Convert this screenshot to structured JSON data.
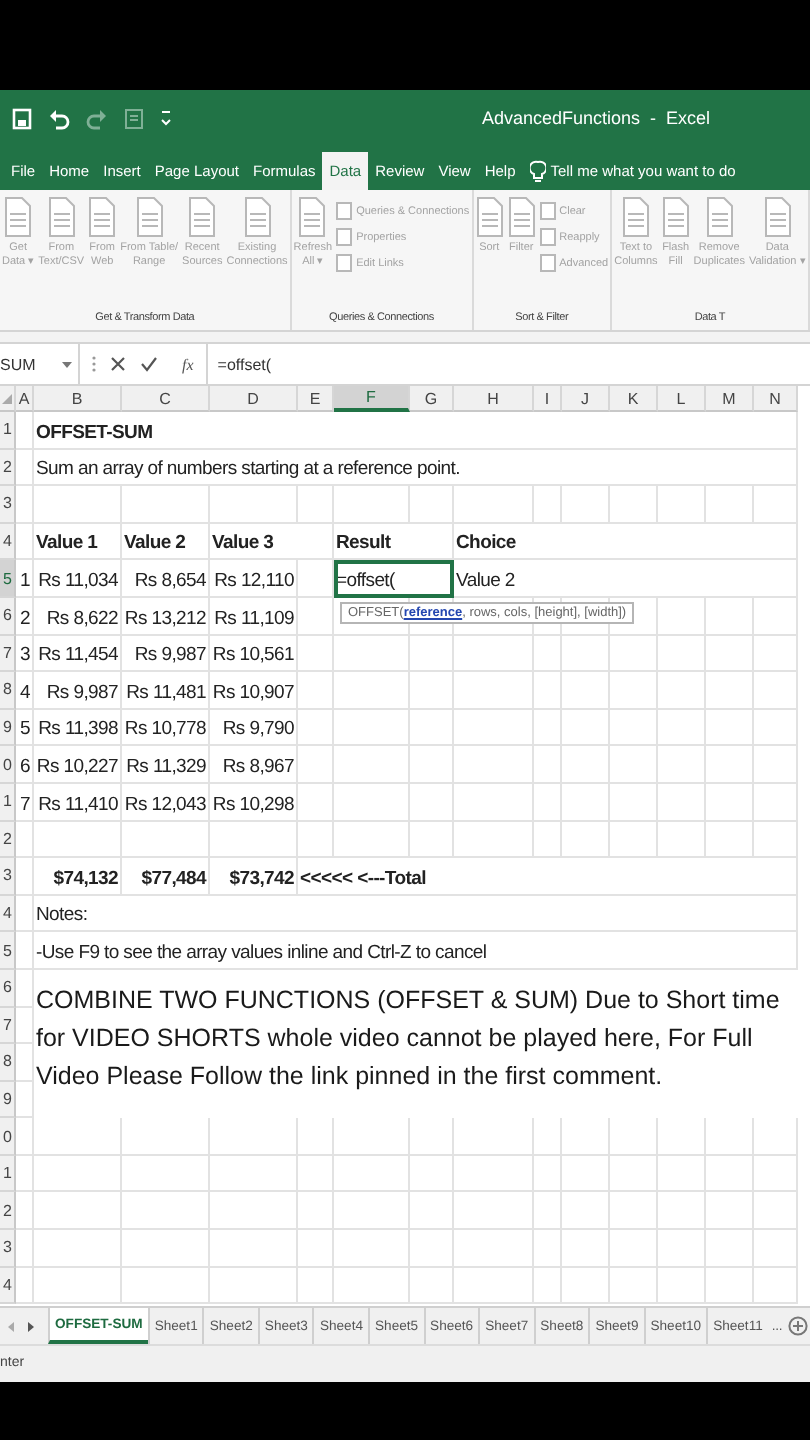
{
  "window": {
    "title": "AdvancedFunctions  -  Excel"
  },
  "ribbon_tabs": [
    {
      "label": "File",
      "selected": false
    },
    {
      "label": "Home",
      "selected": false
    },
    {
      "label": "Insert",
      "selected": false
    },
    {
      "label": "Page Layout",
      "selected": false
    },
    {
      "label": "Formulas",
      "selected": false
    },
    {
      "label": "Data",
      "selected": true
    },
    {
      "label": "Review",
      "selected": false
    },
    {
      "label": "View",
      "selected": false
    },
    {
      "label": "Help",
      "selected": false
    }
  ],
  "tell_me": {
    "label": "Tell me what you want to do"
  },
  "ribbon": {
    "disabled": true,
    "groups": [
      {
        "label": "Get & Transform Data",
        "commands": [
          {
            "kind": "large",
            "label": "Get\nData ▾"
          },
          {
            "kind": "large",
            "label": "From\nText/CSV"
          },
          {
            "kind": "large",
            "label": "From\nWeb"
          },
          {
            "kind": "large",
            "label": "From Table/\nRange"
          },
          {
            "kind": "large",
            "label": "Recent\nSources"
          },
          {
            "kind": "large",
            "label": "Existing\nConnections"
          }
        ]
      },
      {
        "label": "Queries & Connections",
        "commands": [
          {
            "kind": "large",
            "label": "Refresh\nAll ▾"
          },
          {
            "kind": "stack",
            "items": [
              "Queries & Connections",
              "Properties",
              "Edit Links"
            ]
          }
        ]
      },
      {
        "label": "Sort & Filter",
        "commands": [
          {
            "kind": "large",
            "label": "Sort"
          },
          {
            "kind": "large",
            "label": "Filter"
          },
          {
            "kind": "stack",
            "items": [
              "Clear",
              "Reapply",
              "Advanced"
            ]
          }
        ]
      },
      {
        "label": "Data T",
        "commands": [
          {
            "kind": "large",
            "label": "Text to\nColumns"
          },
          {
            "kind": "large",
            "label": "Flash\nFill"
          },
          {
            "kind": "large",
            "label": "Remove\nDuplicates"
          },
          {
            "kind": "large",
            "label": "Data\nValidation ▾"
          }
        ]
      }
    ]
  },
  "formula_bar": {
    "name_box": "SUM",
    "insert_function": "fx",
    "formula": "=offset("
  },
  "columns": [
    {
      "label": "A",
      "selected": false
    },
    {
      "label": "B",
      "selected": false
    },
    {
      "label": "C",
      "selected": false
    },
    {
      "label": "D",
      "selected": false
    },
    {
      "label": "E",
      "selected": false
    },
    {
      "label": "F",
      "selected": true
    },
    {
      "label": "G",
      "selected": false
    },
    {
      "label": "H",
      "selected": false
    },
    {
      "label": "I",
      "selected": false
    },
    {
      "label": "J",
      "selected": false
    },
    {
      "label": "K",
      "selected": false
    },
    {
      "label": "L",
      "selected": false
    },
    {
      "label": "M",
      "selected": false
    },
    {
      "label": "N",
      "selected": false
    }
  ],
  "rows": [
    {
      "number": "1",
      "selected": false,
      "cells": {
        "B": {
          "kind": "text",
          "text": "OFFSET-SUM",
          "bold": true,
          "active": false
        }
      }
    },
    {
      "number": "2",
      "selected": false,
      "cells": {
        "B": {
          "kind": "text",
          "text": "Sum an array of numbers starting at a reference point.",
          "bold": false,
          "active": false
        }
      }
    },
    {
      "number": "3",
      "selected": false
    },
    {
      "number": "4",
      "selected": false,
      "cells": {
        "B": {
          "kind": "text",
          "text": "Value 1",
          "bold": true,
          "active": false
        },
        "C": {
          "kind": "text",
          "text": "Value 2",
          "bold": true,
          "active": false
        },
        "D": {
          "kind": "text",
          "text": "Value 3",
          "bold": true,
          "active": false
        },
        "F": {
          "kind": "text",
          "text": "Result",
          "bold": true,
          "active": false
        },
        "H": {
          "kind": "text",
          "text": "Choice",
          "bold": true,
          "active": false
        }
      }
    },
    {
      "number": "5",
      "selected": true,
      "cells": {
        "A": {
          "kind": "number",
          "text": "1",
          "bold": false,
          "active": false
        },
        "B": {
          "kind": "number",
          "text": "Rs 11,034",
          "bold": false,
          "active": false
        },
        "C": {
          "kind": "number",
          "text": "Rs 8,654",
          "bold": false,
          "active": false
        },
        "D": {
          "kind": "number",
          "text": "Rs 12,110",
          "bold": false,
          "active": false
        },
        "F": {
          "kind": "text",
          "text": "=offset(",
          "bold": false,
          "active": true
        },
        "H": {
          "kind": "text",
          "text": "Value 2",
          "bold": false,
          "active": false
        }
      }
    },
    {
      "number": "6",
      "selected": false,
      "cells": {
        "A": {
          "kind": "number",
          "text": "2",
          "bold": false,
          "active": false
        },
        "B": {
          "kind": "number",
          "text": "Rs 8,622",
          "bold": false,
          "active": false
        },
        "C": {
          "kind": "number",
          "text": "Rs 13,212",
          "bold": false,
          "active": false
        },
        "D": {
          "kind": "number",
          "text": "Rs 11,109",
          "bold": false,
          "active": false
        }
      }
    },
    {
      "number": "7",
      "selected": false,
      "cells": {
        "A": {
          "kind": "number",
          "text": "3",
          "bold": false,
          "active": false
        },
        "B": {
          "kind": "number",
          "text": "Rs 11,454",
          "bold": false,
          "active": false
        },
        "C": {
          "kind": "number",
          "text": "Rs 9,987",
          "bold": false,
          "active": false
        },
        "D": {
          "kind": "number",
          "text": "Rs 10,561",
          "bold": false,
          "active": false
        }
      }
    },
    {
      "number": "8",
      "selected": false,
      "cells": {
        "A": {
          "kind": "number",
          "text": "4",
          "bold": false,
          "active": false
        },
        "B": {
          "kind": "number",
          "text": "Rs 9,987",
          "bold": false,
          "active": false
        },
        "C": {
          "kind": "number",
          "text": "Rs 11,481",
          "bold": false,
          "active": false
        },
        "D": {
          "kind": "number",
          "text": "Rs 10,907",
          "bold": false,
          "active": false
        }
      }
    },
    {
      "number": "9",
      "selected": false,
      "cells": {
        "A": {
          "kind": "number",
          "text": "5",
          "bold": false,
          "active": false
        },
        "B": {
          "kind": "number",
          "text": "Rs 11,398",
          "bold": false,
          "active": false
        },
        "C": {
          "kind": "number",
          "text": "Rs 10,778",
          "bold": false,
          "active": false
        },
        "D": {
          "kind": "number",
          "text": "Rs 9,790",
          "bold": false,
          "active": false
        }
      }
    },
    {
      "number": "0",
      "selected": false,
      "cells": {
        "A": {
          "kind": "number",
          "text": "6",
          "bold": false,
          "active": false
        },
        "B": {
          "kind": "number",
          "text": "Rs 10,227",
          "bold": false,
          "active": false
        },
        "C": {
          "kind": "number",
          "text": "Rs 11,329",
          "bold": false,
          "active": false
        },
        "D": {
          "kind": "number",
          "text": "Rs 8,967",
          "bold": false,
          "active": false
        }
      }
    },
    {
      "number": "1",
      "selected": false,
      "cells": {
        "A": {
          "kind": "number",
          "text": "7",
          "bold": false,
          "active": false
        },
        "B": {
          "kind": "number",
          "text": "Rs 11,410",
          "bold": false,
          "active": false
        },
        "C": {
          "kind": "number",
          "text": "Rs 12,043",
          "bold": false,
          "active": false
        },
        "D": {
          "kind": "number",
          "text": "Rs 10,298",
          "bold": false,
          "active": false
        }
      }
    },
    {
      "number": "2",
      "selected": false
    },
    {
      "number": "3",
      "selected": false,
      "cells": {
        "B": {
          "kind": "number",
          "text": "$74,132",
          "bold": true,
          "active": false
        },
        "C": {
          "kind": "number",
          "text": "$77,484",
          "bold": true,
          "active": false
        },
        "D": {
          "kind": "number",
          "text": "$73,742",
          "bold": true,
          "active": false
        },
        "E": {
          "kind": "text",
          "text": "<<<<< <---Total",
          "bold": true,
          "active": false
        }
      }
    },
    {
      "number": "4",
      "selected": false,
      "cells": {
        "B": {
          "kind": "text",
          "text": "Notes:",
          "bold": false,
          "active": false
        }
      }
    },
    {
      "number": "5",
      "selected": false,
      "cells": {
        "B": {
          "kind": "text",
          "text": "-Use F9 to see the array values inline and Ctrl-Z to cancel",
          "bold": false,
          "active": false
        }
      }
    },
    {
      "number": "6",
      "selected": false
    },
    {
      "number": "7",
      "selected": false
    },
    {
      "number": "8",
      "selected": false
    },
    {
      "number": "9",
      "selected": false
    },
    {
      "number": "0",
      "selected": false
    },
    {
      "number": "1",
      "selected": false
    },
    {
      "number": "2",
      "selected": false
    },
    {
      "number": "3",
      "selected": false
    },
    {
      "number": "4",
      "selected": false
    }
  ],
  "tooltip": {
    "text": "OFFSET(**reference**, rows, cols, [height], [width])"
  },
  "note": {
    "text": "COMBINE TWO FUNCTIONS (OFFSET & SUM) Due to Short time for VIDEO SHORTS whole video cannot be played here, For Full Video Please Follow the link pinned in the first comment."
  },
  "sheet_tabs": [
    {
      "label": "OFFSET-SUM",
      "selected": true
    },
    {
      "label": "Sheet1",
      "selected": false
    },
    {
      "label": "Sheet2",
      "selected": false
    },
    {
      "label": "Sheet3",
      "selected": false
    },
    {
      "label": "Sheet4",
      "selected": false
    },
    {
      "label": "Sheet5",
      "selected": false
    },
    {
      "label": "Sheet6",
      "selected": false
    },
    {
      "label": "Sheet7",
      "selected": false
    },
    {
      "label": "Sheet8",
      "selected": false
    },
    {
      "label": "Sheet9",
      "selected": false
    },
    {
      "label": "Sheet10",
      "selected": false
    },
    {
      "label": "Sheet11",
      "selected": false
    }
  ],
  "more_tabs": "...",
  "status_bar": {
    "mode": "nter"
  }
}
